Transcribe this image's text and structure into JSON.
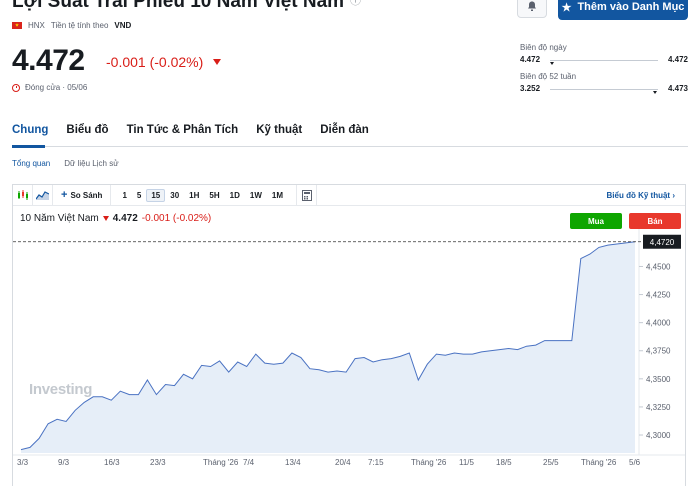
{
  "header": {
    "title": "Lợi Suất Trái Phiếu 10 Năm Việt Nam",
    "watchlist_label": "Thêm vào Danh Mục",
    "exchange": "HNX",
    "currency_label": "Tiền tệ tính theo",
    "currency": "VND"
  },
  "quote": {
    "price": "4.472",
    "change": "-0.001 (-0.02%)",
    "status": "Đóng cửa · 05/06"
  },
  "ranges": {
    "day": {
      "label": "Biên độ ngày",
      "low": "4.472",
      "high": "4.472",
      "position": 0.0
    },
    "week52": {
      "label": "Biên độ 52 tuần",
      "low": "3.252",
      "high": "4.473",
      "position": 0.99
    }
  },
  "tabs": [
    "Chung",
    "Biểu đồ",
    "Tin Tức & Phân Tích",
    "Kỹ thuật",
    "Diễn đàn"
  ],
  "subtabs": [
    "Tổng quan",
    "Dữ liệu Lịch sử"
  ],
  "toolbar": {
    "compare_label": "So Sánh",
    "intervals": [
      "1",
      "5",
      "15",
      "30",
      "1H",
      "5H",
      "1D",
      "1W",
      "1M"
    ],
    "active_interval": "15",
    "advanced_label": "Biểu đồ Kỹ thuật"
  },
  "legend": {
    "name": "10 Năm Việt Nam",
    "price": "4.472",
    "change": "-0.001 (-0.02%)"
  },
  "buy_label": "Mua",
  "sell_label": "Bán",
  "watermark": "Investing",
  "colors": {
    "accent": "#1256a0",
    "negative": "#d91e18",
    "buy": "#0ea600",
    "sell": "#e8382c",
    "line": "#4a72c2",
    "area": "#e6eef8"
  },
  "chart_data": {
    "type": "area",
    "current_label": "4,4720",
    "y_ticks": [
      "4,4500",
      "4,4250",
      "4,4000",
      "4,3750",
      "4,3500",
      "4,3250",
      "4,3000"
    ],
    "y_tick_values": [
      4.45,
      4.425,
      4.4,
      4.375,
      4.35,
      4.325,
      4.3
    ],
    "x_ticks": [
      "3/3",
      "9/3",
      "16/3",
      "23/3",
      "Tháng '26",
      "7/4",
      "13/4",
      "20/4",
      "7:15",
      "Tháng '26",
      "11/5",
      "18/5",
      "25/5",
      "Tháng '26",
      "5/6"
    ],
    "ylim": [
      4.284,
      4.478
    ],
    "values": [
      4.287,
      4.289,
      4.297,
      4.31,
      4.314,
      4.312,
      4.322,
      4.329,
      4.334,
      4.334,
      4.331,
      4.339,
      4.336,
      4.336,
      4.349,
      4.336,
      4.345,
      4.344,
      4.354,
      4.35,
      4.362,
      4.361,
      4.366,
      4.356,
      4.365,
      4.361,
      4.372,
      4.364,
      4.363,
      4.364,
      4.373,
      4.369,
      4.359,
      4.358,
      4.356,
      4.357,
      4.356,
      4.368,
      4.369,
      4.365,
      4.367,
      4.368,
      4.37,
      4.373,
      4.349,
      4.363,
      4.372,
      4.371,
      4.373,
      4.372,
      4.372,
      4.374,
      4.375,
      4.376,
      4.377,
      4.376,
      4.379,
      4.38,
      4.384,
      4.384,
      4.384,
      4.384,
      4.457,
      4.461,
      4.467,
      4.469,
      4.47,
      4.471,
      4.472
    ],
    "last_value": 4.472
  }
}
